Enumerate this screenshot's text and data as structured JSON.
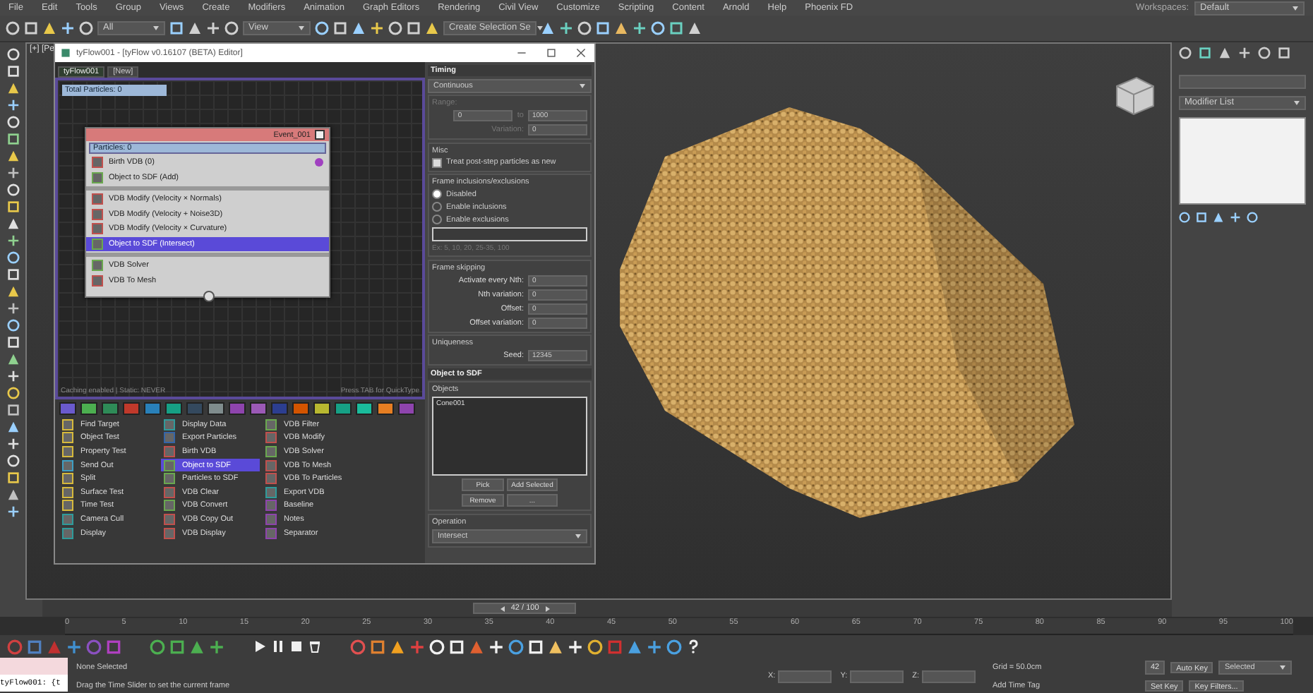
{
  "menu_bar": {
    "items": [
      "File",
      "Edit",
      "Tools",
      "Group",
      "Views",
      "Create",
      "Modifiers",
      "Animation",
      "Graph Editors",
      "Rendering",
      "Civil View",
      "Customize",
      "Scripting",
      "Content",
      "Arnold",
      "Help",
      "Phoenix FD"
    ],
    "workspaces_label": "Workspaces:",
    "workspace": "Default"
  },
  "main_toolbar": {
    "selection_filter": "All",
    "reference_coord": "View",
    "selection_set": "Create Selection Se"
  },
  "viewport": {
    "label": "[+] [Pe"
  },
  "tyflow_editor": {
    "title": "tyFlow001 - [tyFlow v0.16107 (BETA) Editor]",
    "tabs": [
      {
        "label": "tyFlow001",
        "selected": true
      },
      {
        "label": "[New]",
        "selected": false
      }
    ],
    "total_particles": "Total Particles: 0",
    "event": {
      "name": "Event_001",
      "particles": "Particles: 0",
      "operators": [
        {
          "kind": "operator",
          "label": "Birth VDB (0)",
          "color": "#c0504d",
          "selected": false,
          "output": true
        },
        {
          "kind": "operator",
          "label": "Object to SDF (Add)",
          "color": "#6aa84f",
          "selected": false,
          "output": false
        },
        {
          "kind": "separator"
        },
        {
          "kind": "operator",
          "label": "VDB Modify (Velocity × Normals)",
          "color": "#c0504d",
          "selected": false,
          "output": false
        },
        {
          "kind": "operator",
          "label": "VDB Modify (Velocity + Noise3D)",
          "color": "#c0504d",
          "selected": false,
          "output": false
        },
        {
          "kind": "operator",
          "label": "VDB Modify (Velocity × Curvature)",
          "color": "#c0504d",
          "selected": false,
          "output": false
        },
        {
          "kind": "operator",
          "label": "Object to SDF (Intersect)",
          "color": "#6aa84f",
          "selected": true,
          "output": false
        },
        {
          "kind": "separator"
        },
        {
          "kind": "operator",
          "label": "VDB Solver",
          "color": "#6aa84f",
          "selected": false,
          "output": false
        },
        {
          "kind": "operator",
          "label": "VDB To Mesh",
          "color": "#c0504d",
          "selected": false,
          "output": false
        }
      ]
    },
    "status_left": "Caching enabled | Static: NEVER",
    "status_right": "Press TAB for QuickType",
    "palette": [
      {
        "label": "Find Target",
        "color": "#d6b93c",
        "selected": false
      },
      {
        "label": "Object Test",
        "color": "#d6b93c",
        "selected": false
      },
      {
        "label": "Property Test",
        "color": "#d6b93c",
        "selected": false
      },
      {
        "label": "Send Out",
        "color": "#3f9fc4",
        "selected": false
      },
      {
        "label": "Split",
        "color": "#d6b93c",
        "selected": false
      },
      {
        "label": "Surface Test",
        "color": "#d6b93c",
        "selected": false
      },
      {
        "label": "Time Test",
        "color": "#d6b93c",
        "selected": false
      },
      {
        "label": "Camera Cull",
        "color": "#2f9b9b",
        "selected": false
      },
      {
        "label": "Display",
        "color": "#2f9b9b",
        "selected": false
      },
      {
        "label": "Display Data",
        "color": "#2f9b9b",
        "selected": false
      },
      {
        "label": "Export Particles",
        "color": "#3565a8",
        "selected": false
      },
      {
        "label": "Birth VDB",
        "color": "#c0504d",
        "selected": false
      },
      {
        "label": "Object to SDF",
        "color": "#6aa84f",
        "selected": true
      },
      {
        "label": "Particles to SDF",
        "color": "#6aa84f",
        "selected": false
      },
      {
        "label": "VDB Clear",
        "color": "#c0504d",
        "selected": false
      },
      {
        "label": "VDB Convert",
        "color": "#6aa84f",
        "selected": false
      },
      {
        "label": "VDB Copy Out",
        "color": "#c0504d",
        "selected": false
      },
      {
        "label": "VDB Display",
        "color": "#c0504d",
        "selected": false
      },
      {
        "label": "VDB Filter",
        "color": "#6aa84f",
        "selected": false
      },
      {
        "label": "VDB Modify",
        "color": "#c0504d",
        "selected": false
      },
      {
        "label": "VDB Solver",
        "color": "#6aa84f",
        "selected": false
      },
      {
        "label": "VDB To Mesh",
        "color": "#c0504d",
        "selected": false
      },
      {
        "label": "VDB To Particles",
        "color": "#c0504d",
        "selected": false
      },
      {
        "label": "Export VDB",
        "color": "#2f9b9b",
        "selected": false
      },
      {
        "label": "Baseline",
        "color": "#8e44ad",
        "selected": false
      },
      {
        "label": "Notes",
        "color": "#8e44ad",
        "selected": false
      },
      {
        "label": "Separator",
        "color": "#8e44ad",
        "selected": false
      }
    ],
    "timing": {
      "title": "Timing",
      "mode": "Continuous",
      "range_label": "Range:",
      "range_from": "0",
      "range_to_label": "to",
      "range_to": "1000",
      "variation_label": "Variation:",
      "variation": "0",
      "range_disabled": true,
      "misc_title": "Misc",
      "treat_new": {
        "label": "Treat post-step particles as new",
        "checked": true
      },
      "frame_title": "Frame inclusions/exclusions",
      "frame_options": [
        {
          "label": "Disabled",
          "selected": true
        },
        {
          "label": "Enable inclusions",
          "selected": false
        },
        {
          "label": "Enable exclusions",
          "selected": false
        }
      ],
      "frame_hint": "Ex: 5, 10, 20, 25-35, 100",
      "skip_title": "Frame skipping",
      "skip_fields": [
        {
          "label": "Activate every Nth:",
          "value": "0"
        },
        {
          "label": "Nth variation:",
          "value": "0"
        },
        {
          "label": "Offset:",
          "value": "0"
        },
        {
          "label": "Offset variation:",
          "value": "0"
        }
      ],
      "uniqueness_title": "Uniqueness",
      "seed_label": "Seed:",
      "seed": "12345"
    },
    "sdf": {
      "title": "Object to SDF",
      "objects_label": "Objects",
      "objects": [
        "Cone001"
      ],
      "buttons": [
        "Pick",
        "Add Selected",
        "Remove",
        "..."
      ],
      "operation_label": "Operation",
      "operation": "Intersect"
    }
  },
  "command_panel": {
    "modifier_list": "Modifier List"
  },
  "time_slider": {
    "label": "42 / 100",
    "level": 0.42
  },
  "track_bar": {
    "ticks": [
      "0",
      "5",
      "10",
      "15",
      "20",
      "25",
      "30",
      "35",
      "40",
      "45",
      "50",
      "55",
      "60",
      "65",
      "70",
      "75",
      "80",
      "85",
      "90",
      "95",
      "100"
    ]
  },
  "status_bar": {
    "listener": "tyFlow001: {t",
    "selection": "None Selected",
    "prompt": "Drag the Time Slider to set the current frame",
    "coords": [
      "X:",
      "Y:",
      "Z:"
    ],
    "grid": "Grid = 50.0cm",
    "time_tag": "Add Time Tag",
    "auto_key": "Auto Key",
    "key_mode": "Selected",
    "set_key": "Set Key",
    "key_filters": "Key Filters...",
    "frame": "42"
  }
}
